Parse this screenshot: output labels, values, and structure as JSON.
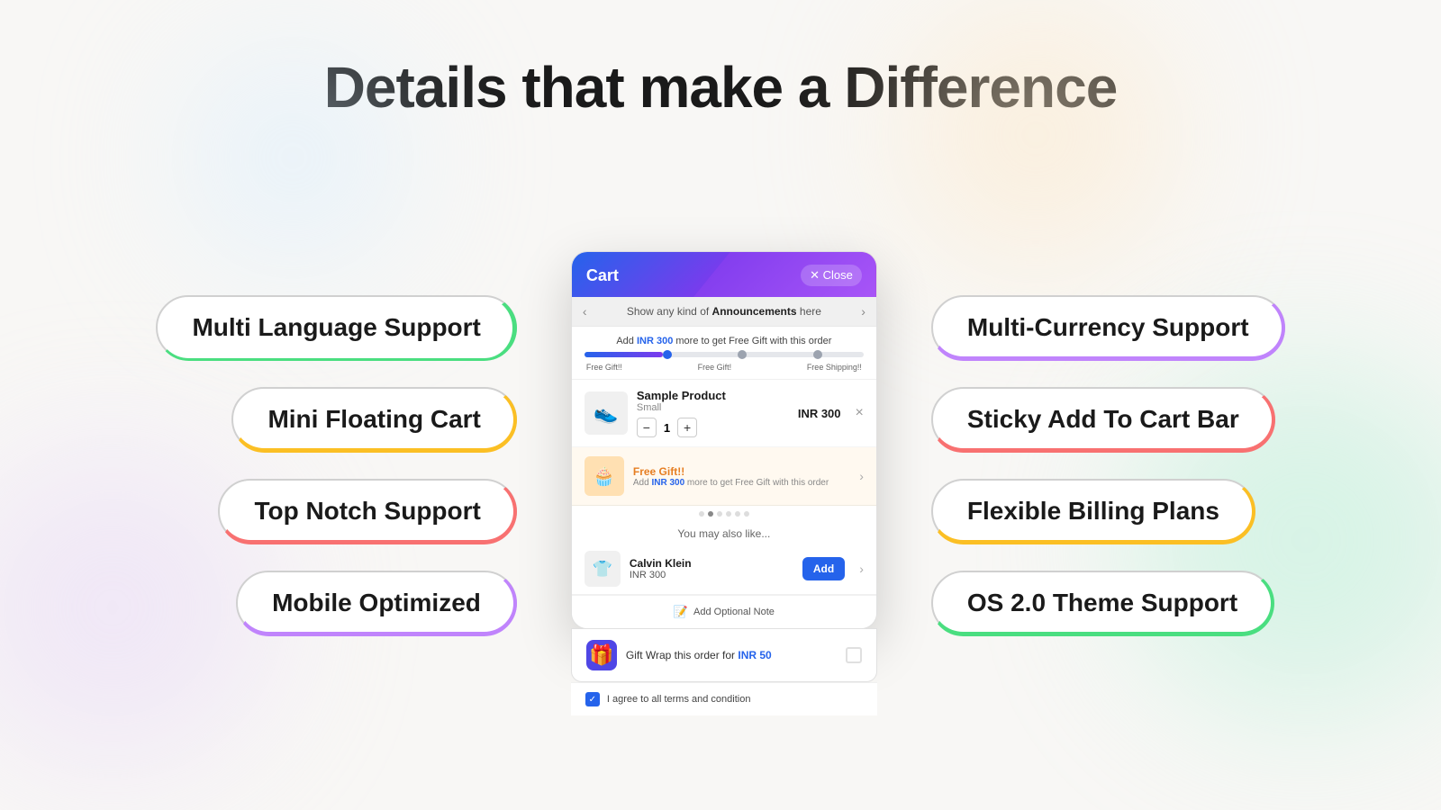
{
  "page": {
    "title": "Details that make a Difference"
  },
  "left_features": [
    {
      "id": "multi-lang",
      "label": "Multi Language Support",
      "accent": "green",
      "class": "pill-multi-lang"
    },
    {
      "id": "mini-cart",
      "label": "Mini Floating Cart",
      "accent": "yellow",
      "class": "pill-mini-cart"
    },
    {
      "id": "top-notch",
      "label": "Top Notch Support",
      "accent": "red",
      "class": "pill-top-notch"
    },
    {
      "id": "mobile-opt",
      "label": "Mobile Optimized",
      "accent": "purple",
      "class": "pill-mobile-opt"
    }
  ],
  "right_features": [
    {
      "id": "multi-currency",
      "label": "Multi-Currency Support",
      "accent": "purple",
      "class": "pill-multi-currency"
    },
    {
      "id": "sticky-cart",
      "label": "Sticky Add To Cart Bar",
      "accent": "red",
      "class": "pill-sticky-cart"
    },
    {
      "id": "flexible-billing",
      "label": "Flexible Billing Plans",
      "accent": "yellow",
      "class": "pill-flexible-billing"
    },
    {
      "id": "os-theme",
      "label": "OS 2.0 Theme Support",
      "accent": "green",
      "class": "pill-os-theme"
    }
  ],
  "cart": {
    "title": "Cart",
    "close_label": "✕ Close",
    "announcement": "Show any kind of",
    "announcement_bold": "Announcements",
    "announcement_suffix": "here",
    "progress_text": "Add",
    "progress_amount": "INR 300",
    "progress_suffix": "more to get Free Gift with this order",
    "progress_labels": [
      "Free Gift!!",
      "Free Gift!",
      "Free Shipping!!"
    ],
    "product_name": "Sample Product",
    "product_variant": "Small",
    "product_qty": "1",
    "product_price": "INR 300",
    "free_gift_title": "Free Gift!!",
    "free_gift_desc_prefix": "Add",
    "free_gift_amount": "INR 300",
    "free_gift_desc_suffix": "more to get Free Gift with this order",
    "you_may_like": "You may also like...",
    "rec_name": "Calvin Klein",
    "rec_price": "INR 300",
    "add_label": "Add",
    "note_label": "Add Optional Note",
    "gift_wrap_text": "Gift Wrap this order for",
    "gift_wrap_price": "INR 50",
    "terms_text": "I agree to all terms and condition"
  }
}
